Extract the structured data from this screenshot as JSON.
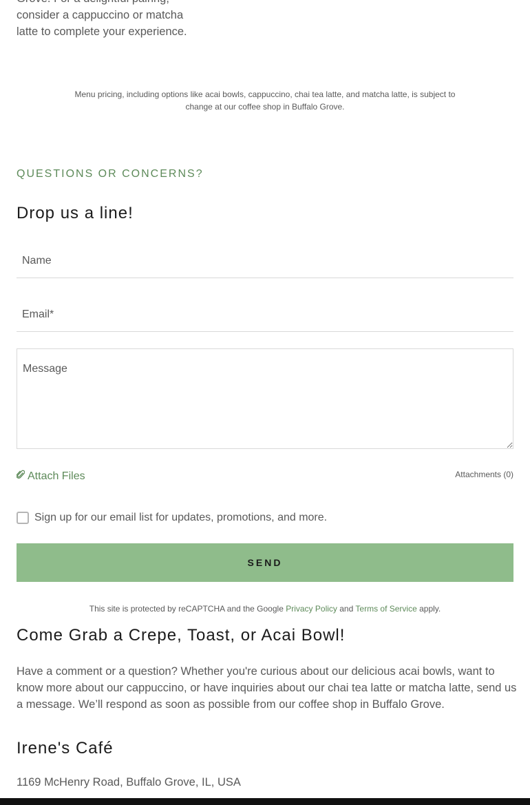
{
  "intro": {
    "text": "Grove. For a delightful pairing, consider a cappuccino or matcha latte to complete your experience."
  },
  "pricing_note": "Menu pricing, including options like acai bowls, cappuccino, chai tea latte, and matcha latte, is subject to change at our coffee shop in Buffalo Grove.",
  "contact_form": {
    "eyebrow": "QUESTIONS OR CONCERNS?",
    "heading": "Drop us a line!",
    "name_placeholder": "Name",
    "email_placeholder": "Email*",
    "message_placeholder": "Message",
    "attach_label": "Attach Files",
    "attachments_count": "Attachments (0)",
    "signup_label": "Sign up for our email list for updates, promotions, and more.",
    "send_label": "SEND",
    "recaptcha": {
      "prefix": "This site is protected by reCAPTCHA and the Google",
      "privacy_link": "Privacy Policy",
      "and": "and",
      "terms_link": "Terms of Service",
      "suffix": "apply."
    }
  },
  "info": {
    "heading": "Come Grab a Crepe, Toast, or Acai Bowl!",
    "body": "Have a comment or a question? Whether you're curious about our delicious acai bowls, want to know more about our cappuccino, or have inquiries about our chai tea latte or matcha latte, send us a message. We’ll respond as soon as possible from our coffee shop in Buffalo Grove.",
    "business_name": "Irene's Café",
    "address": "1169 McHenry Road, Buffalo Grove, IL, USA"
  },
  "colors": {
    "accent": "#5d8a59",
    "button_bg": "#8fbc8b",
    "text_muted": "#595959"
  },
  "icons": {
    "attach": "paperclip-icon"
  }
}
